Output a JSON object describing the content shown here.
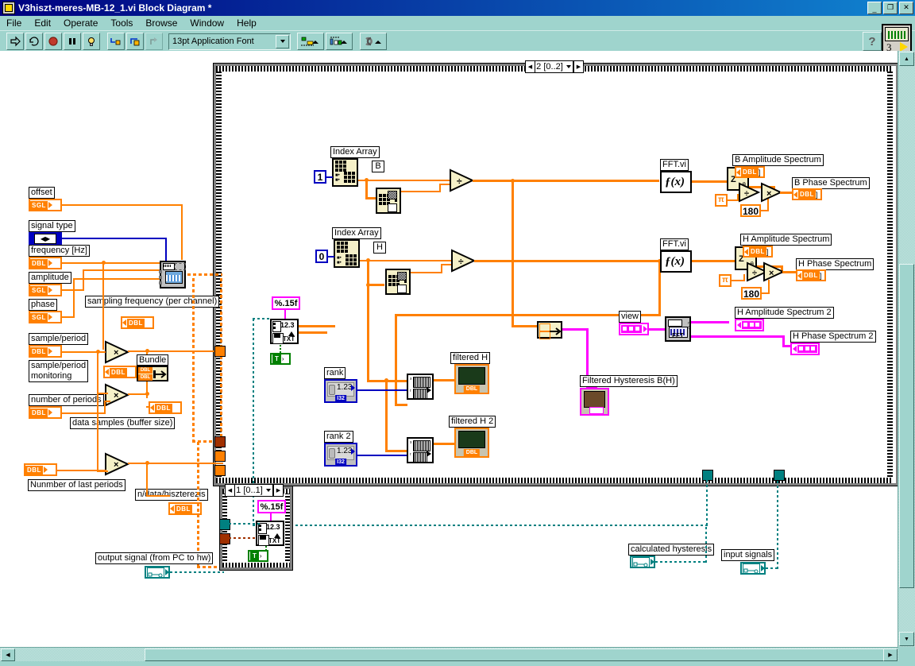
{
  "window": {
    "title": "V3hiszt-meres-MB-12_1.vi Block Diagram *",
    "icon": "labview-vi-icon",
    "minimize": "_",
    "maximize": "❐",
    "close": "×"
  },
  "menu": {
    "items": [
      {
        "label": "File"
      },
      {
        "label": "Edit"
      },
      {
        "label": "Operate"
      },
      {
        "label": "Tools"
      },
      {
        "label": "Browse"
      },
      {
        "label": "Window"
      },
      {
        "label": "Help"
      }
    ]
  },
  "toolbar": {
    "run": "run-arrow-icon",
    "run_continuous": "run-continuous-icon",
    "abort": "abort-icon",
    "pause": "pause-icon",
    "highlight": "highlight-execution-icon",
    "step_into": "step-into-icon",
    "step_over": "step-over-icon",
    "step_out": "step-out-icon",
    "font_selector": "13pt Application Font",
    "align_objects": "align-objects-icon",
    "distribute_objects": "distribute-objects-icon",
    "reorder": "reorder-icon",
    "help": "?",
    "vi_icon_number": "3"
  },
  "diagram": {
    "loop_main_count": "2 [0..2]",
    "loop_bottom_count": "1 [0..1]",
    "labels": {
      "offset": "offset",
      "signal_type": "signal type",
      "frequency": "frequency [Hz]",
      "amplitude": "amplitude",
      "phase": "phase",
      "sample_period": "sample/period",
      "sample_period_monitoring": "sample/period\nmonitoring",
      "number_of_periods": "number of periods",
      "number_of_last_periods": "Nunmber of last periods",
      "data_samples": "data samples (buffer size)",
      "sampling_frequency": "sampling frequency (per channel)",
      "n_data_hiszterezis": "n/data/hiszterezis",
      "output_signal": "output signal  (from PC to hw)",
      "calculated_hysteresis": "calculated hysteresis",
      "input_signals": "input signals",
      "index_array_1": "Index Array",
      "index_array_2": "Index Array",
      "tag_b": "B",
      "tag_h": "H",
      "fft_vi_1": "FFT.vi",
      "fft_vi_2": "FFT.vi",
      "b_amplitude_spectrum": "B Amplitude Spectrum",
      "b_phase_spectrum": "B Phase Spectrum",
      "h_amplitude_spectrum": "H Amplitude Spectrum",
      "h_phase_spectrum": "H Phase Spectrum",
      "h_amplitude_spectrum_2": "H Amplitude Spectrum 2",
      "h_phase_spectrum_2": "H Phase Spectrum 2",
      "view": "view",
      "rank": "rank",
      "rank_2": "rank 2",
      "filtered_h": "filtered H",
      "filtered_h_2": "filtered H 2",
      "filtered_hysteresis": "Filtered Hysteresis B(H)",
      "bundle": "Bundle",
      "fft_node": "FFT"
    },
    "constants": {
      "index_1": "1",
      "index_0": "0",
      "deg_1": "180",
      "deg_2": "180",
      "pi_1": "π",
      "pi_2": "π",
      "format_1": "%.15f",
      "format_2": "%.15f",
      "true_1": "T",
      "true_2": "T",
      "rank_value": "1.23",
      "rank2_value": "1.23"
    },
    "datatypes": {
      "sgl": "SGL",
      "dbl": "DBL",
      "i32": "I32"
    },
    "fx_glyph": "ƒ(x)",
    "zr_labels": {
      "z": "Z",
      "r": "r",
      "theta": "θ"
    },
    "op_glyphs": {
      "multiply": "×",
      "divide": "÷"
    }
  },
  "colors": {
    "title_bar_start": "#000080",
    "title_bar_end": "#1084d0",
    "chrome": "#9fd4cd",
    "wire_orange": "#ff8000",
    "wire_blue": "#0000c0",
    "wire_pink": "#ff00ff",
    "wire_teal": "#008080",
    "node_fill": "#f5f0c8",
    "structure_gray": "#808080",
    "canvas": "#ffffff"
  }
}
